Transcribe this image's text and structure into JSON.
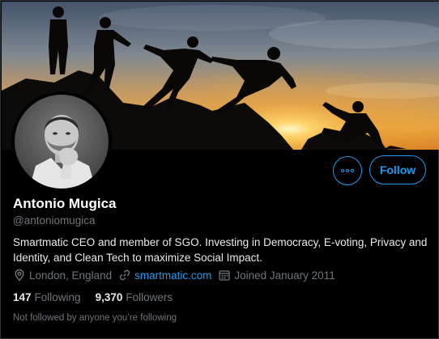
{
  "profile": {
    "name": "Antonio Mugica",
    "handle": "@antoniomugica",
    "bio": "Smartmatic CEO and member of SGO. Investing in Democracy, E-voting, Privacy and Identity, and Clean Tech to maximize   Social Impact.",
    "location": "London, England",
    "website": "smartmatic.com",
    "joined": "Joined January 2011",
    "following_count": "147",
    "following_label": "Following",
    "followers_count": "9,370",
    "followers_label": "Followers",
    "followed_by_note": "Not followed by anyone you’re following"
  },
  "actions": {
    "more_icon": "more-horizontal-icon",
    "follow_label": "Follow"
  },
  "icons": {
    "location": "location-pin-icon",
    "website": "link-icon",
    "joined": "calendar-icon"
  },
  "colors": {
    "accent": "#1d9bf0",
    "background": "#000000",
    "secondary_text": "#6e767d",
    "primary_text": "#e7e9ea"
  }
}
